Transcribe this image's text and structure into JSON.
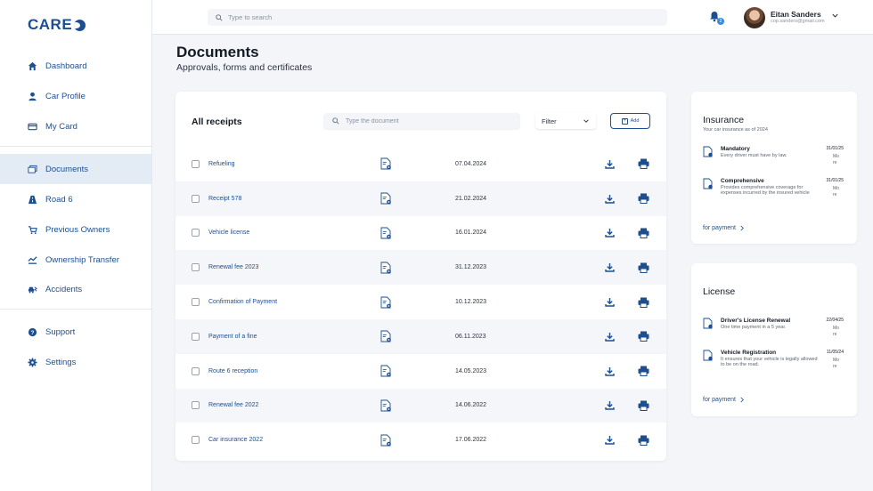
{
  "brand": {
    "logo": "CARE"
  },
  "sidebar": {
    "items": [
      {
        "label": "Dashboard",
        "icon": "home-icon"
      },
      {
        "label": "Car Profile",
        "icon": "user-icon"
      },
      {
        "label": "My Card",
        "icon": "card-icon"
      },
      {
        "label": "Documents",
        "icon": "documents-icon",
        "active": true
      },
      {
        "label": "Road 6",
        "icon": "road-icon"
      },
      {
        "label": "Previous Owners",
        "icon": "owners-icon"
      },
      {
        "label": "Ownership Transfer",
        "icon": "transfer-icon"
      },
      {
        "label": "Accidents",
        "icon": "accident-icon"
      },
      {
        "label": "Support",
        "icon": "help-icon"
      },
      {
        "label": "Settings",
        "icon": "gear-icon"
      }
    ]
  },
  "topbar": {
    "search_placeholder": "Type to search",
    "notifications_count": "2",
    "user_name": "Eitan Sanders",
    "user_email": "cop.sanders@gmail.com"
  },
  "header": {
    "title": "Documents",
    "subtitle": "Approvals, forms and certificates"
  },
  "receipts": {
    "title": "All receipts",
    "search_placeholder": "Type the document",
    "filter_label": "Filter",
    "add_label": "Add",
    "rows": [
      {
        "name": "Refueling",
        "date": "07.04.2024"
      },
      {
        "name": "Receipt 578",
        "date": "21.02.2024"
      },
      {
        "name": "Vehicle license",
        "date": "16.01.2024"
      },
      {
        "name": "Renewal fee 2023",
        "date": "31.12.2023"
      },
      {
        "name": "Confirmation of Payment",
        "date": "10.12.2023"
      },
      {
        "name": "Payment of a fine",
        "date": "06.11.2023"
      },
      {
        "name": "Route 6 reception",
        "date": "14.05.2023"
      },
      {
        "name": "Renewal fee 2022",
        "date": "14.06.2022"
      },
      {
        "name": "Car insurance 2022",
        "date": "17.06.2022"
      }
    ]
  },
  "insurance": {
    "title": "Insurance",
    "subtitle": "Your car insurance as of 2024",
    "items": [
      {
        "name": "Mandatory",
        "desc": "Every driver must have by law.",
        "date": "31/01/25",
        "more": "More"
      },
      {
        "name": "Comprehensive",
        "desc": "Provides comprehensive coverage for expenses incurred by the insured vehicle",
        "date": "31/01/25",
        "more": "More"
      }
    ],
    "link": "for payment"
  },
  "license": {
    "title": "License",
    "items": [
      {
        "name": "Driver's License Renewal",
        "desc": "One time payment in a 5 year.",
        "date": "22/04/25",
        "more": "More"
      },
      {
        "name": "Vehicle Registration",
        "desc": "It ensures that your vehicle is legally allowed to be on the road.",
        "date": "11/05/24",
        "more": "More"
      }
    ],
    "link": "for payment"
  },
  "colors": {
    "accent": "#1d4f8f",
    "active_bg": "#e3ebf5",
    "page_bg": "#f3f5f9"
  }
}
